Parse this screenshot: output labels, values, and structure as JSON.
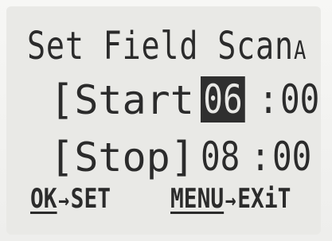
{
  "screen": {
    "title": "Set Field Scan",
    "slot": "A"
  },
  "rows": [
    {
      "label": "Start",
      "hour": "06",
      "minute": "00",
      "hour_selected": true
    },
    {
      "label": "Stop ",
      "hour": "08",
      "minute": "00",
      "hour_selected": false
    }
  ],
  "footer": {
    "ok_key": "OK",
    "ok_action": "SET",
    "menu_key": "MENU",
    "menu_action": "EXiT",
    "arrow": "→"
  },
  "colors": {
    "lcd_background": "#e9e9e6",
    "lcd_text": "#2b2b2b",
    "selection": "#2f2f2f"
  }
}
